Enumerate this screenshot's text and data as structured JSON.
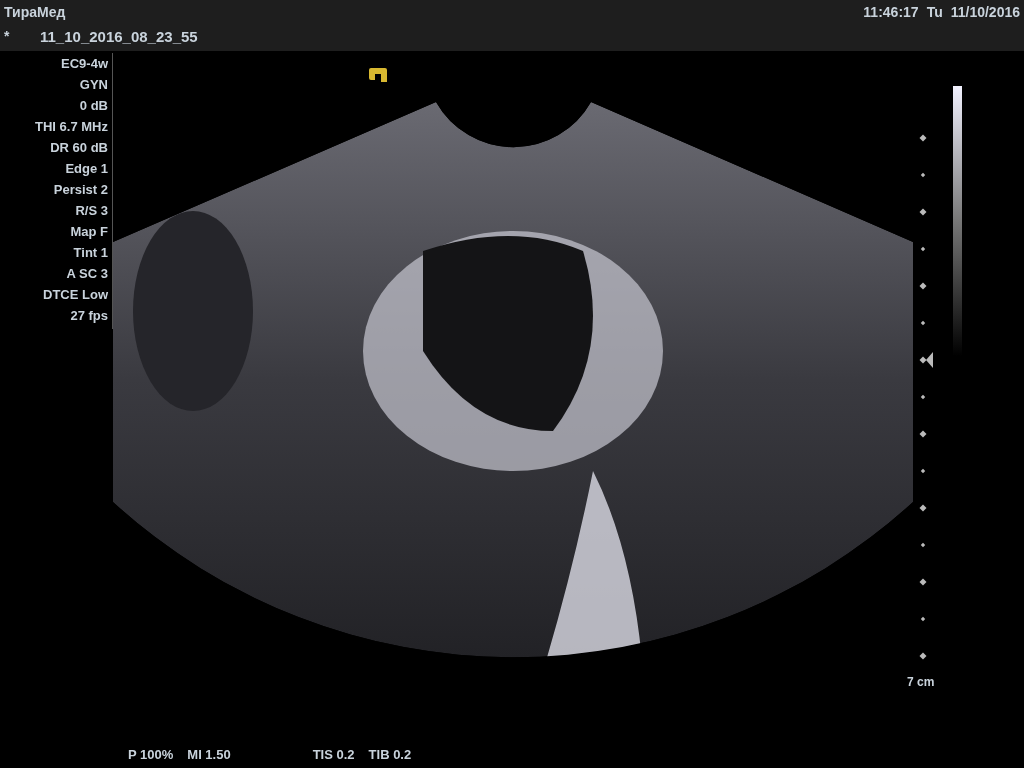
{
  "app_title": "ТираМед",
  "clock": {
    "time": "11:46:17",
    "day": "Tu",
    "date": "11/10/2016"
  },
  "file": {
    "marker": "*",
    "name": "11_10_2016_08_23_55"
  },
  "parameters": [
    "EC9-4w",
    "GYN",
    "0 dB",
    "THI 6.7 MHz",
    "DR 60 dB",
    "Edge 1",
    "Persist 2",
    "R/S 3",
    "Map F",
    "Tint 1",
    "A SC 3",
    "DTCE Low",
    "27 fps"
  ],
  "depth": "7 cm",
  "output_indices": [
    "P 100%",
    "MI 1.50"
  ],
  "thermal_indices": [
    "TIS 0.2",
    "TIB 0.2"
  ]
}
